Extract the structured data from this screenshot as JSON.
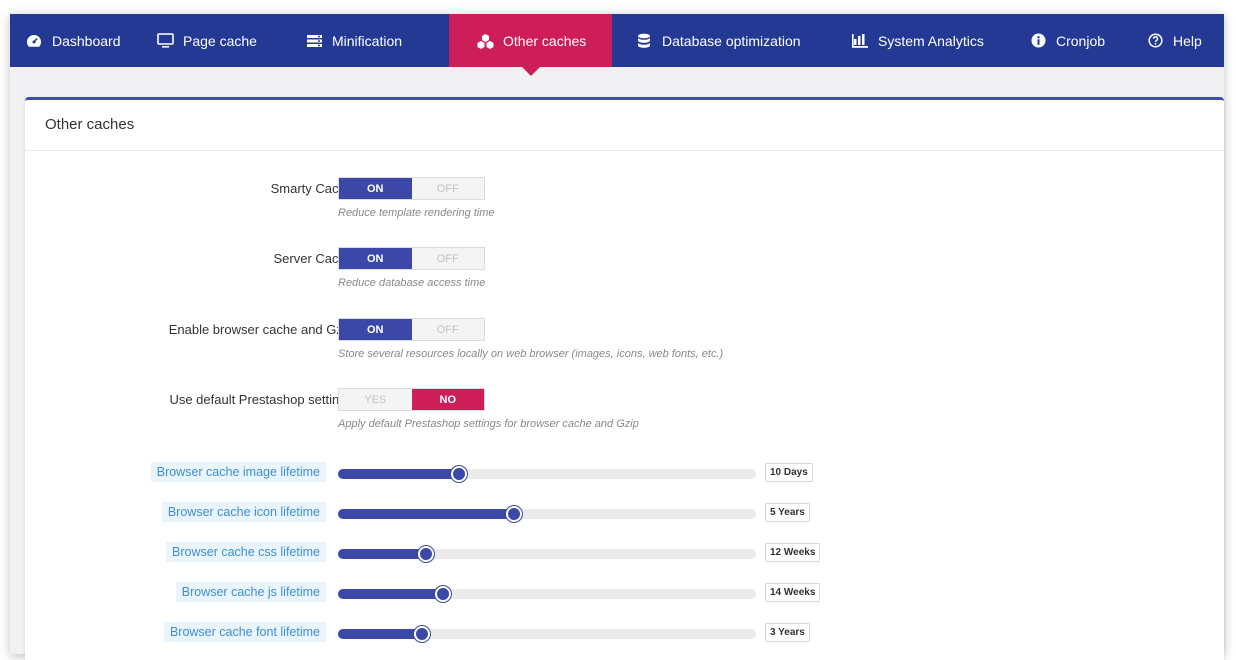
{
  "nav": {
    "items": [
      {
        "label": "Dashboard",
        "icon": "dashboard-icon"
      },
      {
        "label": "Page cache",
        "icon": "monitor-icon"
      },
      {
        "label": "Minification",
        "icon": "layers-icon"
      },
      {
        "label": "Other caches",
        "icon": "cubes-icon",
        "active": true
      },
      {
        "label": "Database optimization",
        "icon": "database-icon"
      },
      {
        "label": "System Analytics",
        "icon": "bar-chart-icon"
      },
      {
        "label": "Cronjob",
        "icon": "info-icon"
      },
      {
        "label": "Help",
        "icon": "help-icon"
      }
    ]
  },
  "panel": {
    "title": "Other caches"
  },
  "settings": [
    {
      "label": "Smarty Cache",
      "on": "ON",
      "off": "OFF",
      "value": "ON",
      "help": "Reduce template rendering time"
    },
    {
      "label": "Server Cache",
      "on": "ON",
      "off": "OFF",
      "value": "ON",
      "help": "Reduce database access time"
    },
    {
      "label": "Enable browser cache and Gzip",
      "on": "ON",
      "off": "OFF",
      "value": "ON",
      "help": "Store several resources locally on web browser (images, icons, web fonts, etc.)"
    },
    {
      "label": "Use default Prestashop settings",
      "on": "YES",
      "off": "NO",
      "value": "NO",
      "help": "Apply default Prestashop settings for browser cache and Gzip"
    }
  ],
  "sliders": [
    {
      "label": "Browser cache image lifetime",
      "value": "10 Days",
      "level": 0.29
    },
    {
      "label": "Browser cache icon lifetime",
      "value": "5 Years",
      "level": 0.42
    },
    {
      "label": "Browser cache css lifetime",
      "value": "12 Weeks",
      "level": 0.21
    },
    {
      "label": "Browser cache js lifetime",
      "value": "14 Weeks",
      "level": 0.25
    },
    {
      "label": "Browser cache font lifetime",
      "value": "3 Years",
      "level": 0.2
    }
  ],
  "colors": {
    "nav_bg": "#233993",
    "active": "#cd1e59",
    "accent": "#3b48a8"
  }
}
